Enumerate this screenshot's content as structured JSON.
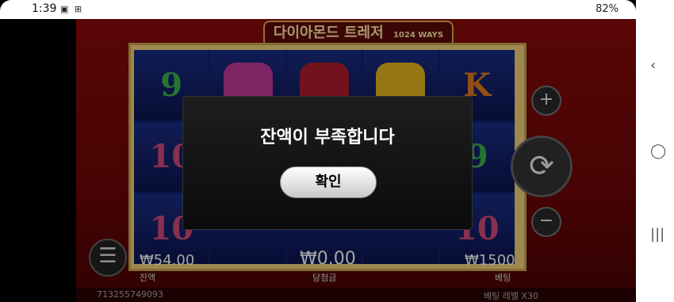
{
  "status_bar": {
    "time": "1:39",
    "left_icons": "▣ ⊞",
    "right_text": "82%"
  },
  "game": {
    "title": "다이아몬드 트레저",
    "ways": "1024 WAYS",
    "reels": [
      [
        "9",
        "gem-pink",
        "gem-red",
        "gem-yellow",
        "K"
      ],
      [
        "10",
        "",
        "",
        "",
        "9"
      ],
      [
        "10",
        "",
        "",
        "",
        "10"
      ]
    ],
    "balance": "₩54.00",
    "balance_label": "잔액",
    "win": "₩0.00",
    "win_label": "당첨금",
    "bet": "₩1500",
    "bet_label": "베팅",
    "session_id": "713255749093",
    "bet_level": "베팅 레벨 X30"
  },
  "modal": {
    "message": "잔액이 부족합니다",
    "confirm_label": "확인"
  },
  "colors": {
    "background": "#8a0a0a",
    "gold": "#d7b05a"
  }
}
